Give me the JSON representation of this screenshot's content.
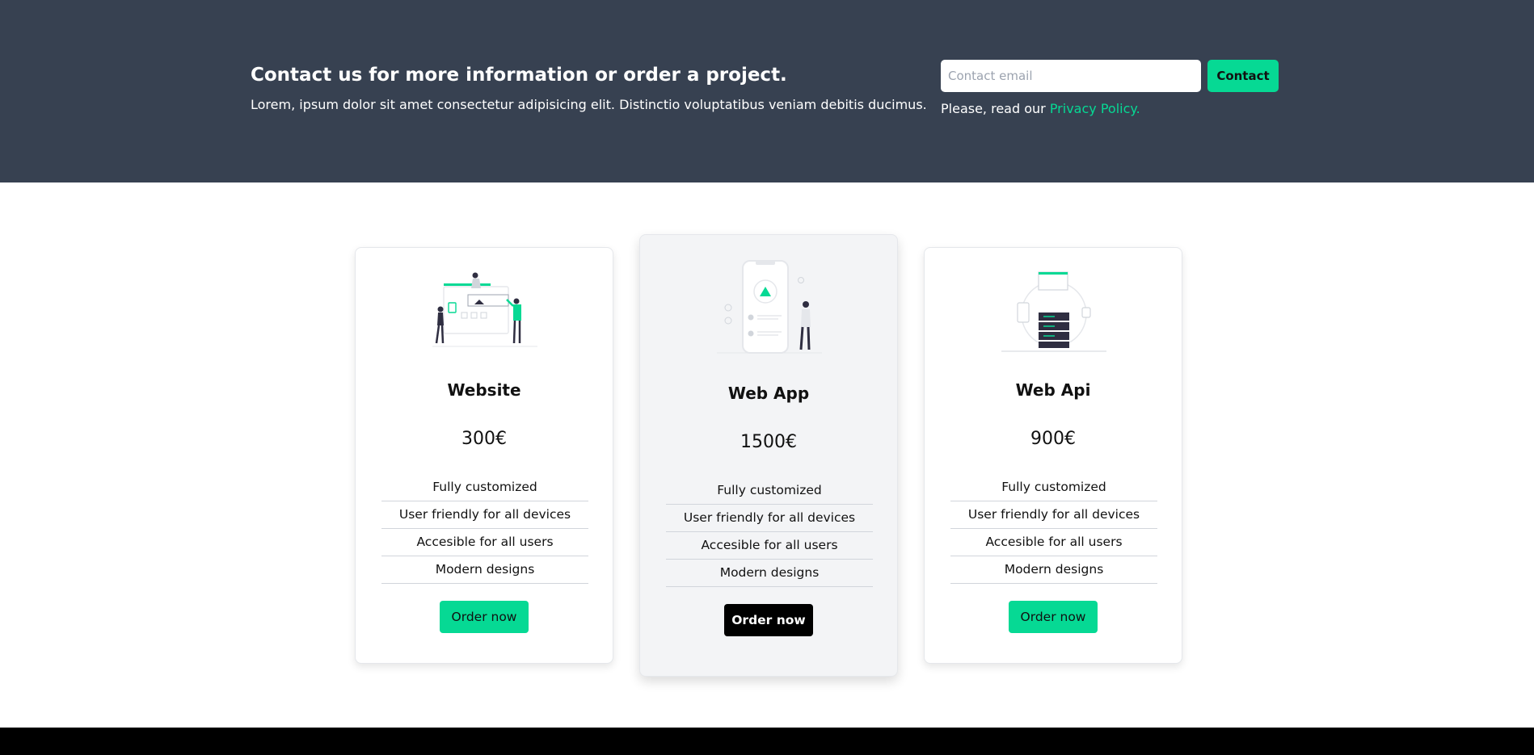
{
  "contact": {
    "heading": "Contact us for more information or order a project.",
    "text": "Lorem, ipsum dolor sit amet consectetur adipisicing elit. Distinctio voluptatibus veniam debitis ducimus.",
    "email_placeholder": "Contact email",
    "email_value": "",
    "button_label": "Contact",
    "privacy_prefix": "Please, read our ",
    "privacy_link": "Privacy Policy."
  },
  "colors": {
    "banner_bg": "#374151",
    "accent": "#06d994",
    "featured_card_bg": "#f3f4f6",
    "footer": "#000000"
  },
  "cards": [
    {
      "illustration": "website-illustration-icon",
      "title": "Website",
      "price": "300€",
      "features": [
        "Fully customized",
        "User friendly for all devices",
        "Accesible for all users",
        "Modern designs"
      ],
      "button_label": "Order now"
    },
    {
      "illustration": "web-app-illustration-icon",
      "title": "Web App",
      "price": "1500€",
      "features": [
        "Fully customized",
        "User friendly for all devices",
        "Accesible for all users",
        "Modern designs"
      ],
      "button_label": "Order now"
    },
    {
      "illustration": "web-api-illustration-icon",
      "title": "Web Api",
      "price": "900€",
      "features": [
        "Fully customized",
        "User friendly for all devices",
        "Accesible for all users",
        "Modern designs"
      ],
      "button_label": "Order now"
    }
  ]
}
